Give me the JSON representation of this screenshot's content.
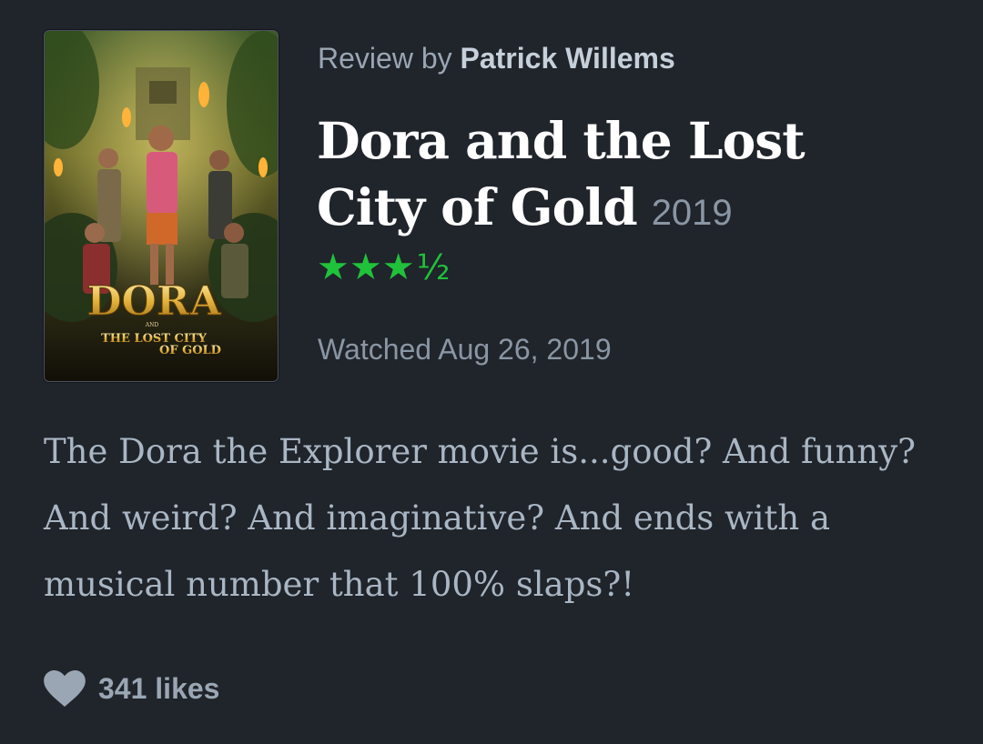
{
  "review": {
    "byline_prefix": "Review by",
    "author": "Patrick Willems",
    "film_title": "Dora and the Lost City of Gold",
    "year": "2019",
    "rating_stars": "★★★",
    "rating_half": "½",
    "rating_value": 3.5,
    "watched": "Watched Aug 26, 2019",
    "text": "The Dora the Explorer movie is...good? And funny? And weird? And imaginative? And ends with a musical number that 100% slaps?!",
    "likes": "341 likes"
  },
  "poster": {
    "logo_word": "DORA",
    "logo_line1": "AND",
    "logo_line2": "THE LOST CITY",
    "logo_line3": "OF GOLD"
  },
  "colors": {
    "background": "#20242b",
    "star_green": "#1fc23a",
    "title_white": "#ffffff",
    "muted_text": "#8a96a3"
  },
  "icons": {
    "like": "heart-icon"
  }
}
